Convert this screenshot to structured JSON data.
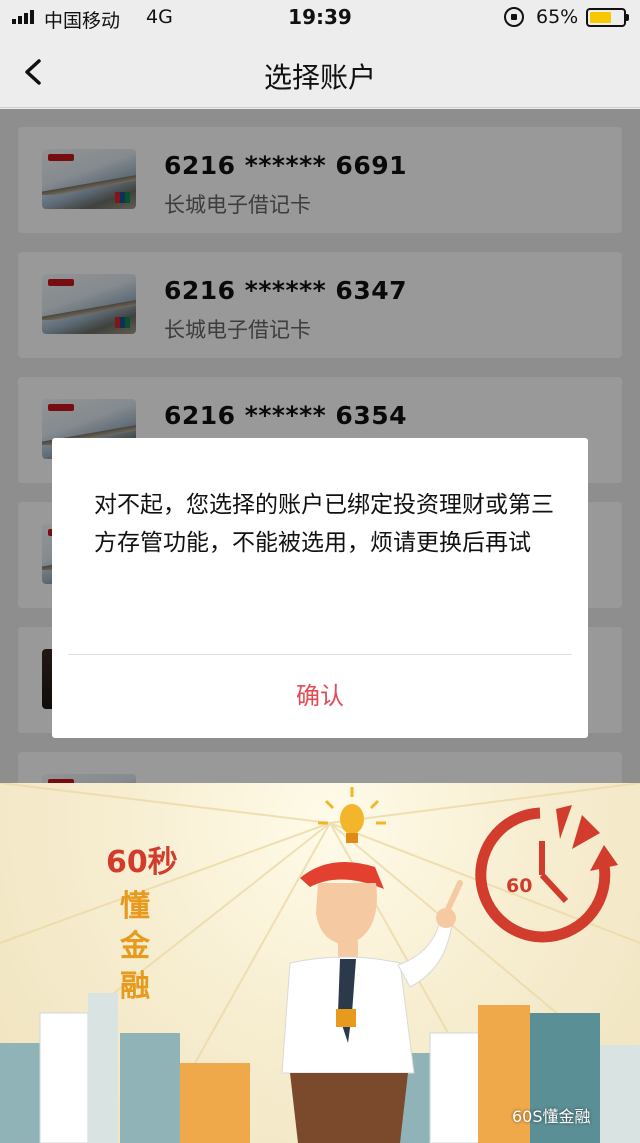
{
  "status_bar": {
    "carrier": "中国移动",
    "network": "4G",
    "time": "19:39",
    "battery_pct": "65%",
    "battery_level": 0.65,
    "battery_color": "#f7c800"
  },
  "nav": {
    "back_icon": "chevron-left-icon",
    "title": "选择账户"
  },
  "accounts": [
    {
      "number": "6216 ****** 6691",
      "type": "长城电子借记卡"
    },
    {
      "number": "6216 ****** 6347",
      "type": "长城电子借记卡"
    },
    {
      "number": "6216 ****** 6354",
      "type": ""
    },
    {
      "number": "",
      "type": ""
    },
    {
      "number": "",
      "type": ""
    },
    {
      "number": "",
      "type": ""
    }
  ],
  "dialog": {
    "message": "对不起，您选择的账户已绑定投资理财或第三方存管功能，不能被选用，烦请更换后再试",
    "confirm_label": "确认",
    "confirm_color": "#e24b55"
  },
  "poster": {
    "brand_seconds": "60秒",
    "brand_chars": [
      "懂",
      "金",
      "融"
    ],
    "timer_label": "60",
    "watermark": "60S懂金融",
    "brand_color": "#d13c2d",
    "accent_color": "#e79a1d"
  }
}
